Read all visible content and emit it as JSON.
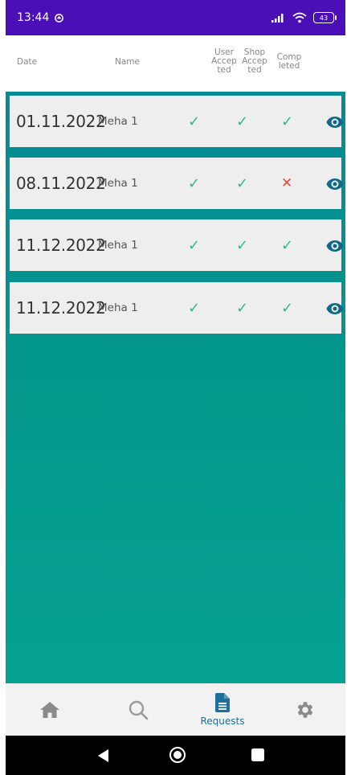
{
  "status": {
    "time": "13:44",
    "battery": "43"
  },
  "header": {
    "date": "Date",
    "name": "Name",
    "user_accepted": [
      "User",
      "Accep",
      "ted"
    ],
    "shop_accepted": [
      "Shop",
      "Accep",
      "ted"
    ],
    "completed": [
      "Comp",
      "leted"
    ]
  },
  "rows": [
    {
      "date": "01.11.2022",
      "name": "Meha 1",
      "user_accepted": true,
      "shop_accepted": true,
      "completed": true
    },
    {
      "date": "08.11.2022",
      "name": "Meha 1",
      "user_accepted": true,
      "shop_accepted": true,
      "completed": false
    },
    {
      "date": "11.12.2022",
      "name": "Meha 1",
      "user_accepted": true,
      "shop_accepted": true,
      "completed": true
    },
    {
      "date": "11.12.2022",
      "name": "Meha 1",
      "user_accepted": true,
      "shop_accepted": true,
      "completed": true
    }
  ],
  "marks": {
    "yes": "✓",
    "no": "✕"
  },
  "nav": {
    "items": [
      {
        "icon": "home-icon"
      },
      {
        "icon": "search-icon"
      },
      {
        "icon": "document-icon",
        "label": "Requests",
        "active": true
      },
      {
        "icon": "gear-icon"
      }
    ]
  },
  "colors": {
    "status_bar": "#4b0fb8",
    "teal": "#068a96",
    "accent": "#1f6f9a",
    "check": "#2fb88f",
    "cross": "#e14a3a"
  }
}
